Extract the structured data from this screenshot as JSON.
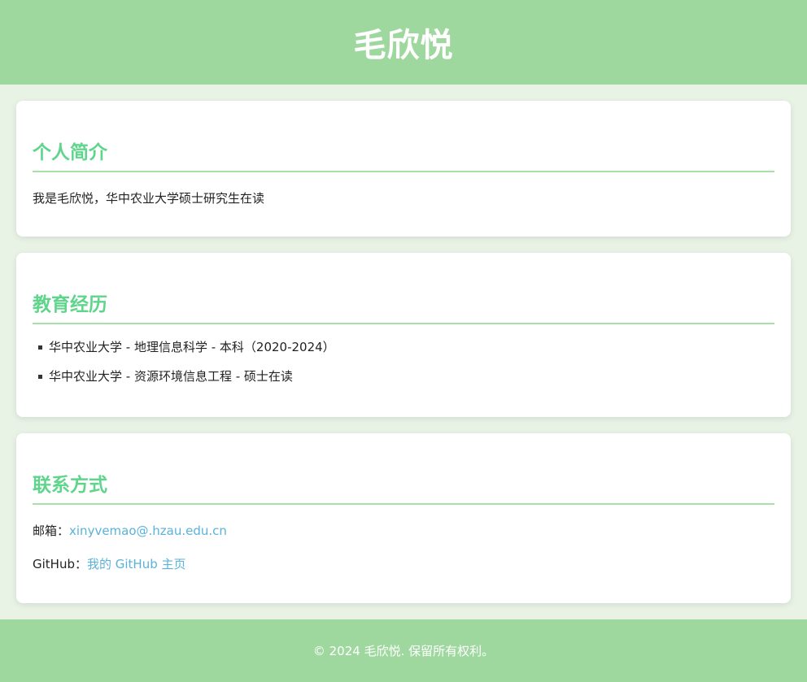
{
  "header": {
    "title": "毛欣悦"
  },
  "about": {
    "heading": "个人简介",
    "text": "我是毛欣悦，华中农业大学硕士研究生在读"
  },
  "education": {
    "heading": "教育经历",
    "items": [
      "华中农业大学 - 地理信息科学 - 本科（2020-2024）",
      "华中农业大学 - 资源环境信息工程 - 硕士在读"
    ]
  },
  "contact": {
    "heading": "联系方式",
    "email_label": "邮箱：",
    "email_value": "xinyvemao@.hzau.edu.cn",
    "github_label": "GitHub：",
    "github_link_text": "我的 GitHub 主页"
  },
  "footer": {
    "text": "© 2024 毛欣悦. 保留所有权利。"
  },
  "colors": {
    "header_bg": "#9fd89f",
    "page_bg": "#e8f3e6",
    "heading": "#5fd58c",
    "link": "#5ab2da"
  }
}
